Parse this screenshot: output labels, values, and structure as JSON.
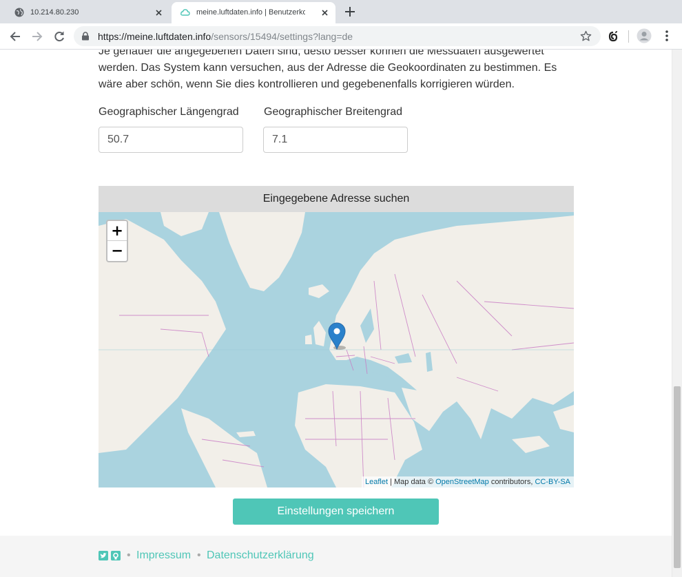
{
  "browser": {
    "tabs": [
      {
        "title": "10.214.80.230",
        "active": false
      },
      {
        "title": "meine.luftdaten.info | Benutzerkonfi",
        "active": true
      }
    ],
    "url_host": "https://meine.luftdaten.info",
    "url_path": "/sensors/15494/settings?lang=de"
  },
  "page": {
    "intro_text": "Je genauer die angegebenen Daten sind, desto besser können die Messdaten ausgewertet werden. Das System kann versuchen, aus der Adresse die Geokoordinaten zu bestimmen. Es wäre aber schön, wenn Sie dies kontrollieren und gegebenenfalls korrigieren würden.",
    "longitude_label": "Geographischer Längengrad",
    "longitude_value": "50.7",
    "latitude_label": "Geographischer Breitengrad",
    "latitude_value": "7.1",
    "search_address_button": "Eingegebene Adresse suchen",
    "save_button": "Einstellungen speichern"
  },
  "map": {
    "zoom_in": "+",
    "zoom_out": "−",
    "attribution_leaflet": "Leaflet",
    "attribution_mapdata": "| Map data ©",
    "attribution_osm": "OpenStreetMap",
    "attribution_contributors": "contributors,",
    "attribution_license": "CC-BY-SA",
    "colors": {
      "water": "#aad3df",
      "land": "#f2efe9",
      "borders": "#c97bc4",
      "marker": "#2a81cb"
    }
  },
  "footer": {
    "icons": [
      "twitter-icon",
      "github-icon"
    ],
    "links": [
      "Impressum",
      "Datenschutzerklärung"
    ],
    "separator": "•",
    "accent_color": "#4fc6b7"
  }
}
